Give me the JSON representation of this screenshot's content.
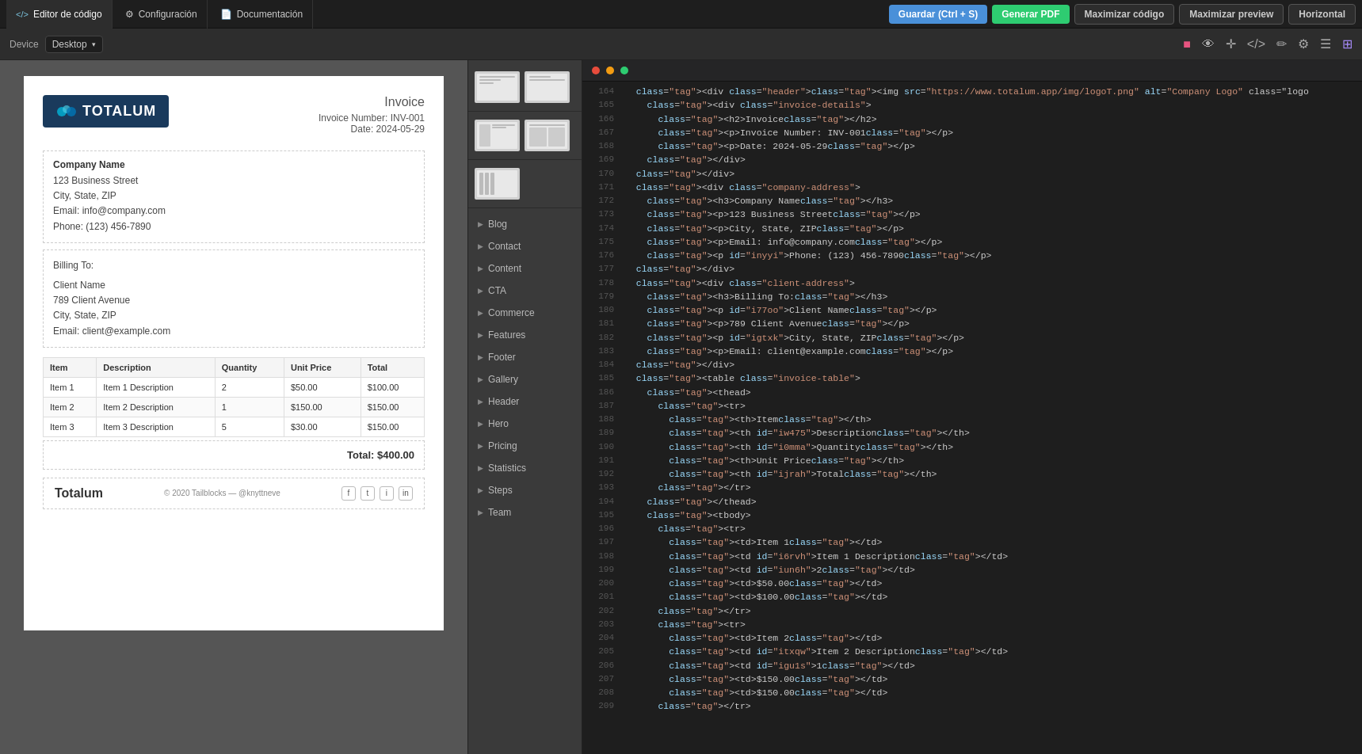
{
  "topbar": {
    "tabs": [
      {
        "label": "Editor de código",
        "icon": "</>",
        "active": true
      },
      {
        "label": "Configuración",
        "icon": "⚙",
        "active": false
      },
      {
        "label": "Documentación",
        "icon": "📄",
        "active": false
      }
    ],
    "buttons": {
      "save": "Guardar (Ctrl + S)",
      "generate": "Generar PDF",
      "maxCode": "Maximizar código",
      "maxPreview": "Maximizar preview",
      "horizontal": "Horizontal"
    }
  },
  "toolbar2": {
    "device_label": "Device",
    "device_value": "Desktop"
  },
  "invoice": {
    "logo_text": "TOTALUM",
    "title": "Invoice",
    "number_label": "Invoice Number:",
    "number_value": "INV-001",
    "date_label": "Date:",
    "date_value": "2024-05-29",
    "company": {
      "name": "Company Name",
      "address": "123 Business Street",
      "city": "City, State, ZIP",
      "email": "Email: info@company.com",
      "phone": "Phone: (123) 456-7890"
    },
    "billing": {
      "label": "Billing To:",
      "name": "Client Name",
      "address": "789 Client Avenue",
      "city": "City, State, ZIP",
      "email": "Email: client@example.com"
    },
    "table": {
      "headers": [
        "Item",
        "Description",
        "Quantity",
        "Unit Price",
        "Total"
      ],
      "rows": [
        {
          "item": "Item 1",
          "desc": "Item 1 Description",
          "qty": "2",
          "unit": "$50.00",
          "total": "$100.00"
        },
        {
          "item": "Item 2",
          "desc": "Item 2 Description",
          "qty": "1",
          "unit": "$150.00",
          "total": "$150.00"
        },
        {
          "item": "Item 3",
          "desc": "Item 3 Description",
          "qty": "5",
          "unit": "$30.00",
          "total": "$150.00"
        }
      ]
    },
    "total": "Total: $400.00",
    "footer": {
      "brand": "Totalum",
      "copyright": "© 2020 Tailblocks — @knyttneve",
      "social_icons": [
        "f",
        "t",
        "i",
        "in"
      ]
    }
  },
  "sidebar": {
    "items": [
      {
        "label": "Blog"
      },
      {
        "label": "Contact"
      },
      {
        "label": "Content"
      },
      {
        "label": "CTA"
      },
      {
        "label": "Commerce"
      },
      {
        "label": "Features"
      },
      {
        "label": "Footer"
      },
      {
        "label": "Gallery"
      },
      {
        "label": "Header"
      },
      {
        "label": "Hero"
      },
      {
        "label": "Pricing"
      },
      {
        "label": "Statistics"
      },
      {
        "label": "Steps"
      },
      {
        "label": "Team"
      }
    ]
  },
  "code": {
    "lines": [
      {
        "num": "164",
        "content": "  <div class=\"header\"><img src=\"https://www.totalum.app/img/logoT.png\" alt=\"Company Logo\" class=\"logo"
      },
      {
        "num": "165",
        "content": "    <div class=\"invoice-details\">"
      },
      {
        "num": "166",
        "content": "      <h2>Invoice</h2>"
      },
      {
        "num": "167",
        "content": "      <p>Invoice Number: INV-001</p>"
      },
      {
        "num": "168",
        "content": "      <p>Date: 2024-05-29</p>"
      },
      {
        "num": "169",
        "content": "    </div>"
      },
      {
        "num": "170",
        "content": "  </div>"
      },
      {
        "num": "171",
        "content": "  <div class=\"company-address\">"
      },
      {
        "num": "172",
        "content": "    <h3>Company Name</h3>"
      },
      {
        "num": "173",
        "content": "    <p>123 Business Street</p>"
      },
      {
        "num": "174",
        "content": "    <p>City, State, ZIP</p>"
      },
      {
        "num": "175",
        "content": "    <p>Email: info@company.com</p>"
      },
      {
        "num": "176",
        "content": "    <p id=\"inyyi\">Phone: (123) 456-7890</p>"
      },
      {
        "num": "177",
        "content": "  </div>"
      },
      {
        "num": "178",
        "content": "  <div class=\"client-address\">"
      },
      {
        "num": "179",
        "content": "    <h3>Billing To:</h3>"
      },
      {
        "num": "180",
        "content": "    <p id=\"i77oo\">Client Name</p>"
      },
      {
        "num": "181",
        "content": "    <p>789 Client Avenue</p>"
      },
      {
        "num": "182",
        "content": "    <p id=\"igtxk\">City, State, ZIP</p>"
      },
      {
        "num": "183",
        "content": "    <p>Email: client@example.com</p>"
      },
      {
        "num": "184",
        "content": "  </div>"
      },
      {
        "num": "185",
        "content": "  <table class=\"invoice-table\">"
      },
      {
        "num": "186",
        "content": "    <thead>"
      },
      {
        "num": "187",
        "content": "      <tr>"
      },
      {
        "num": "188",
        "content": "        <th>Item</th>"
      },
      {
        "num": "189",
        "content": "        <th id=\"iw475\">Description</th>"
      },
      {
        "num": "190",
        "content": "        <th id=\"i0mma\">Quantity</th>"
      },
      {
        "num": "191",
        "content": "        <th>Unit Price</th>"
      },
      {
        "num": "192",
        "content": "        <th id=\"ijrah\">Total</th>"
      },
      {
        "num": "193",
        "content": "      </tr>"
      },
      {
        "num": "194",
        "content": "    </thead>"
      },
      {
        "num": "195",
        "content": "    <tbody>"
      },
      {
        "num": "196",
        "content": "      <tr>"
      },
      {
        "num": "197",
        "content": "        <td>Item 1</td>"
      },
      {
        "num": "198",
        "content": "        <td id=\"i6rvh\">Item 1 Description</td>"
      },
      {
        "num": "199",
        "content": "        <td id=\"iun6h\">2</td>"
      },
      {
        "num": "200",
        "content": "        <td>$50.00</td>"
      },
      {
        "num": "201",
        "content": "        <td>$100.00</td>"
      },
      {
        "num": "202",
        "content": "      </tr>"
      },
      {
        "num": "203",
        "content": "      <tr>"
      },
      {
        "num": "204",
        "content": "        <td>Item 2</td>"
      },
      {
        "num": "205",
        "content": "        <td id=\"itxqw\">Item 2 Description</td>"
      },
      {
        "num": "206",
        "content": "        <td id=\"igu1s\">1</td>"
      },
      {
        "num": "207",
        "content": "        <td>$150.00</td>"
      },
      {
        "num": "208",
        "content": "        <td>$150.00</td>"
      },
      {
        "num": "209",
        "content": "      </tr>"
      }
    ]
  }
}
